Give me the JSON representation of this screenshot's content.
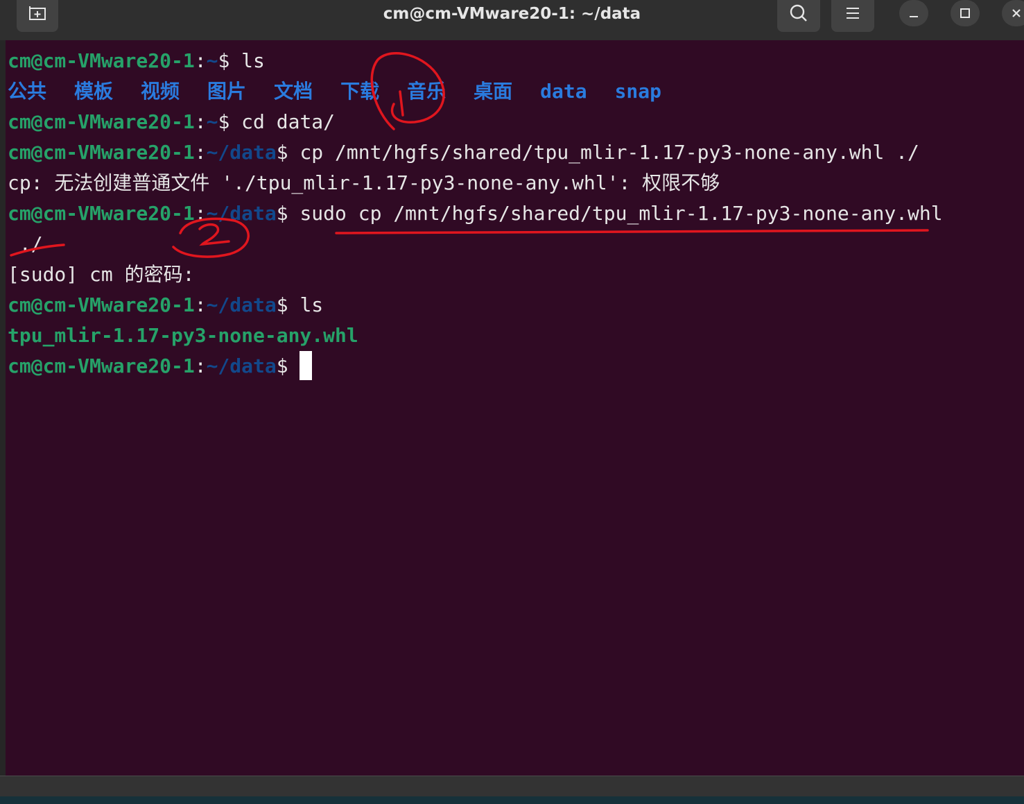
{
  "window": {
    "title": "cm@cm-VMware20-1: ~/data"
  },
  "terminal": {
    "lines": {
      "l1": {
        "user": "cm@cm-VMware20-1",
        "sep": ":",
        "path": "~",
        "sym": "$ ",
        "cmd": "ls"
      },
      "l2": {
        "dirs": [
          "公共",
          "模板",
          "视频",
          "图片",
          "文档",
          "下载",
          "音乐",
          "桌面",
          "data",
          "snap"
        ]
      },
      "l3": {
        "user": "cm@cm-VMware20-1",
        "sep": ":",
        "path": "~",
        "sym": "$ ",
        "cmd": "cd data/"
      },
      "l4": {
        "user": "cm@cm-VMware20-1",
        "sep": ":",
        "path": "~/data",
        "sym": "$ ",
        "cmd": "cp /mnt/hgfs/shared/tpu_mlir-1.17-py3-none-any.whl ./"
      },
      "l5": {
        "text": "cp: 无法创建普通文件 './tpu_mlir-1.17-py3-none-any.whl': 权限不够"
      },
      "l6": {
        "user": "cm@cm-VMware20-1",
        "sep": ":",
        "path": "~/data",
        "sym": "$ ",
        "cmd": "sudo cp /mnt/hgfs/shared/tpu_mlir-1.17-py3-none-any.whl"
      },
      "l7": {
        "text": " ./"
      },
      "l8": {
        "text": "[sudo] cm 的密码:"
      },
      "l9": {
        "user": "cm@cm-VMware20-1",
        "sep": ":",
        "path": "~/data",
        "sym": "$ ",
        "cmd": "ls"
      },
      "l10": {
        "file": "tpu_mlir-1.17-py3-none-any.whl"
      },
      "l11": {
        "user": "cm@cm-VMware20-1",
        "sep": ":",
        "path": "~/data",
        "sym": "$ "
      }
    }
  },
  "annotations": {
    "mark1": "1",
    "mark2": "2"
  },
  "colors": {
    "terminal_bg": "#300a24",
    "prompt_user": "#26a269",
    "prompt_path": "#12488b",
    "directory": "#2a7bde",
    "annotation_red": "#e0161e"
  }
}
